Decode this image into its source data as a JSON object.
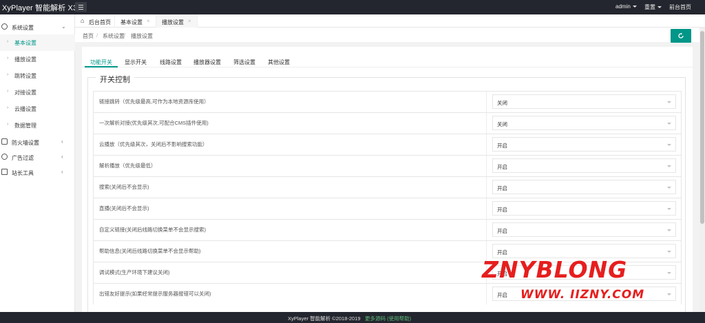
{
  "header": {
    "logo": "XyPlayer 智能解析 X3",
    "user_menu": "admin",
    "cache_menu": "重置",
    "front_link": "前台首页"
  },
  "sidebar": {
    "groups": [
      {
        "label": "系统设置",
        "icon": "gear-icon"
      },
      {
        "label": "防火墙设置",
        "icon": "shield-icon"
      },
      {
        "label": "广告过滤",
        "icon": "filter-icon"
      },
      {
        "label": "站长工具",
        "icon": "grid-icon"
      }
    ],
    "items": [
      {
        "label": "基本设置",
        "active": true
      },
      {
        "label": "播放设置"
      },
      {
        "label": "跳转设置"
      },
      {
        "label": "对接设置"
      },
      {
        "label": "云播设置"
      },
      {
        "label": "数据管理"
      }
    ]
  },
  "tabs": [
    {
      "label": "后台首页",
      "icon": "home-icon"
    },
    {
      "label": "基本设置",
      "close": "×"
    },
    {
      "label": "播放设置",
      "close": "×",
      "active": true
    }
  ],
  "breadcrumb": [
    "首页",
    "/",
    "系统设置",
    "/",
    "播放设置"
  ],
  "subtabs": [
    "功能开关",
    "显示开关",
    "线路设置",
    "播放器设置",
    "筛选设置",
    "其他设置"
  ],
  "section_title": "开关控制",
  "rows": [
    {
      "label": "链接跳转（优先级最高,可作为本地资源库使用）",
      "value": "关闭"
    },
    {
      "label": "一次解析对接(优先级其次,可配合CMS插件使用)",
      "value": "关闭"
    },
    {
      "label": "云播放（优先级其次，关闭后不影响搜索功能）",
      "value": "开启"
    },
    {
      "label": "解析播放（优先级最低）",
      "value": "开启"
    },
    {
      "label": "搜索(关闭后不会显示)",
      "value": "开启"
    },
    {
      "label": "直播(关闭后不会显示)",
      "value": "开启"
    },
    {
      "label": "自定义链接(关闭后线路切换菜单不会显示搜索)",
      "value": "开启"
    },
    {
      "label": "帮助信息(关闭后线路切换菜单不会显示帮助)",
      "value": "开启"
    },
    {
      "label": "调试模式(生产环境下建议关闭)",
      "value": "开启"
    },
    {
      "label": "出错友好提示(如果经常提示服务器报错可以关闭)",
      "value": "开启"
    }
  ],
  "footer": {
    "text": "XyPlayer 智能解析 ©2018-2019",
    "link": "更多源码 (使用帮助)"
  },
  "watermark": {
    "line1": "ZNYBLONG",
    "line2": "WWW. IIZNY.COM"
  },
  "colors": {
    "accent": "#009688",
    "topbar": "#23262e",
    "watermark": "#e61e1e"
  }
}
